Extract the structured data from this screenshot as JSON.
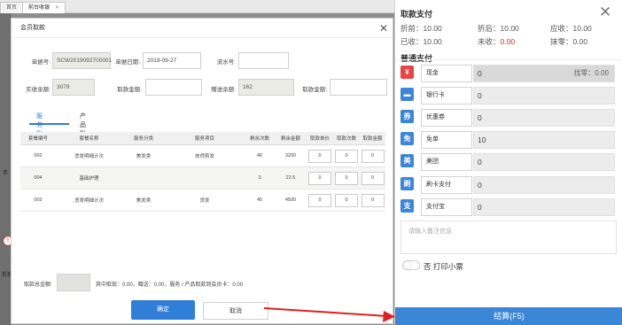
{
  "tabs": [
    {
      "label": "首页"
    },
    {
      "label": "前台收银",
      "active": true
    }
  ],
  "background": {
    "left_text_1": "手",
    "left_text_2": "折前",
    "warn_icon": "!"
  },
  "dialog": {
    "title": "会员取款",
    "fields": {
      "order_no_label": "单据号:",
      "order_no": "SCW2019092700001",
      "date_label": "单据日期:",
      "date": "2019-09-27",
      "flow_label": "流水号:",
      "flow": "",
      "real_balance_label": "实收余额:",
      "real_balance": "3079",
      "withdraw_label": "取款金额:",
      "withdraw": "",
      "gift_balance_label": "赠送余额:",
      "gift_balance": "162",
      "withdraw2_label": "取款金额:",
      "withdraw2": ""
    },
    "tabs": [
      "服务账户",
      "产品账户"
    ],
    "table": {
      "headers": [
        "套餐编号",
        "套餐名称",
        "服务分类",
        "服务项目",
        "剩余次数",
        "剩余金额",
        "取款单价",
        "取款次数",
        "取款金额"
      ],
      "rows": [
        [
          "002",
          "烫发明细计次",
          "美发类",
          "技师剪发",
          "40",
          "3200",
          "0",
          "0",
          "0"
        ],
        [
          "004",
          "基础护理",
          "",
          "",
          "3",
          "22.5",
          "0",
          "0",
          "0"
        ],
        [
          "002",
          "烫发明细计次",
          "美发类",
          "烫发",
          "45",
          "4500",
          "0",
          "0",
          "0"
        ]
      ]
    },
    "total_label": "取款总金额:",
    "total_note": "其中取现：0.00，赠送：0.00，服务 / 产品取款到会员卡：0.00",
    "ok_label": "确定",
    "cancel_label": "取消"
  },
  "panel": {
    "title": "取款支付",
    "summary": {
      "before_label": "折前：",
      "before": "10.00",
      "after_label": "折后：",
      "after": "10.00",
      "receivable_label": "应收：",
      "receivable": "10.00",
      "received_label": "已收：",
      "received": "10.00",
      "unreceived_label": "未收：",
      "unreceived": "0.00",
      "rounding_label": "抹零：",
      "rounding": "0.00"
    },
    "section_title": "普通支付",
    "payments": [
      {
        "name": "现金",
        "value": "0",
        "icon": "cash-icon",
        "glyph": "¥",
        "color": "#e64545"
      },
      {
        "name": "银行卡",
        "value": "0",
        "icon": "bank-card-icon",
        "glyph": "▬",
        "color": "#3b86d9"
      },
      {
        "name": "优惠券",
        "value": "0",
        "icon": "coupon-icon",
        "glyph": "券",
        "color": "#3b86d9"
      },
      {
        "name": "免单",
        "value": "10",
        "icon": "free-order-icon",
        "glyph": "免",
        "color": "#3b86d9"
      },
      {
        "name": "美团",
        "value": "0",
        "icon": "meituan-icon",
        "glyph": "美",
        "color": "#3b86d9"
      },
      {
        "name": "刷卡支付",
        "value": "0",
        "icon": "card-swipe-icon",
        "glyph": "刷",
        "color": "#3b86d9"
      },
      {
        "name": "支付宝",
        "value": "0",
        "icon": "alipay-icon",
        "glyph": "支",
        "color": "#3b86d9"
      }
    ],
    "change_label": "找零：",
    "change": "0.00",
    "memo_placeholder": "请输入备注信息",
    "toggle_state": "否",
    "print_label": "打印小票",
    "settle_label": "结算(F5)"
  }
}
